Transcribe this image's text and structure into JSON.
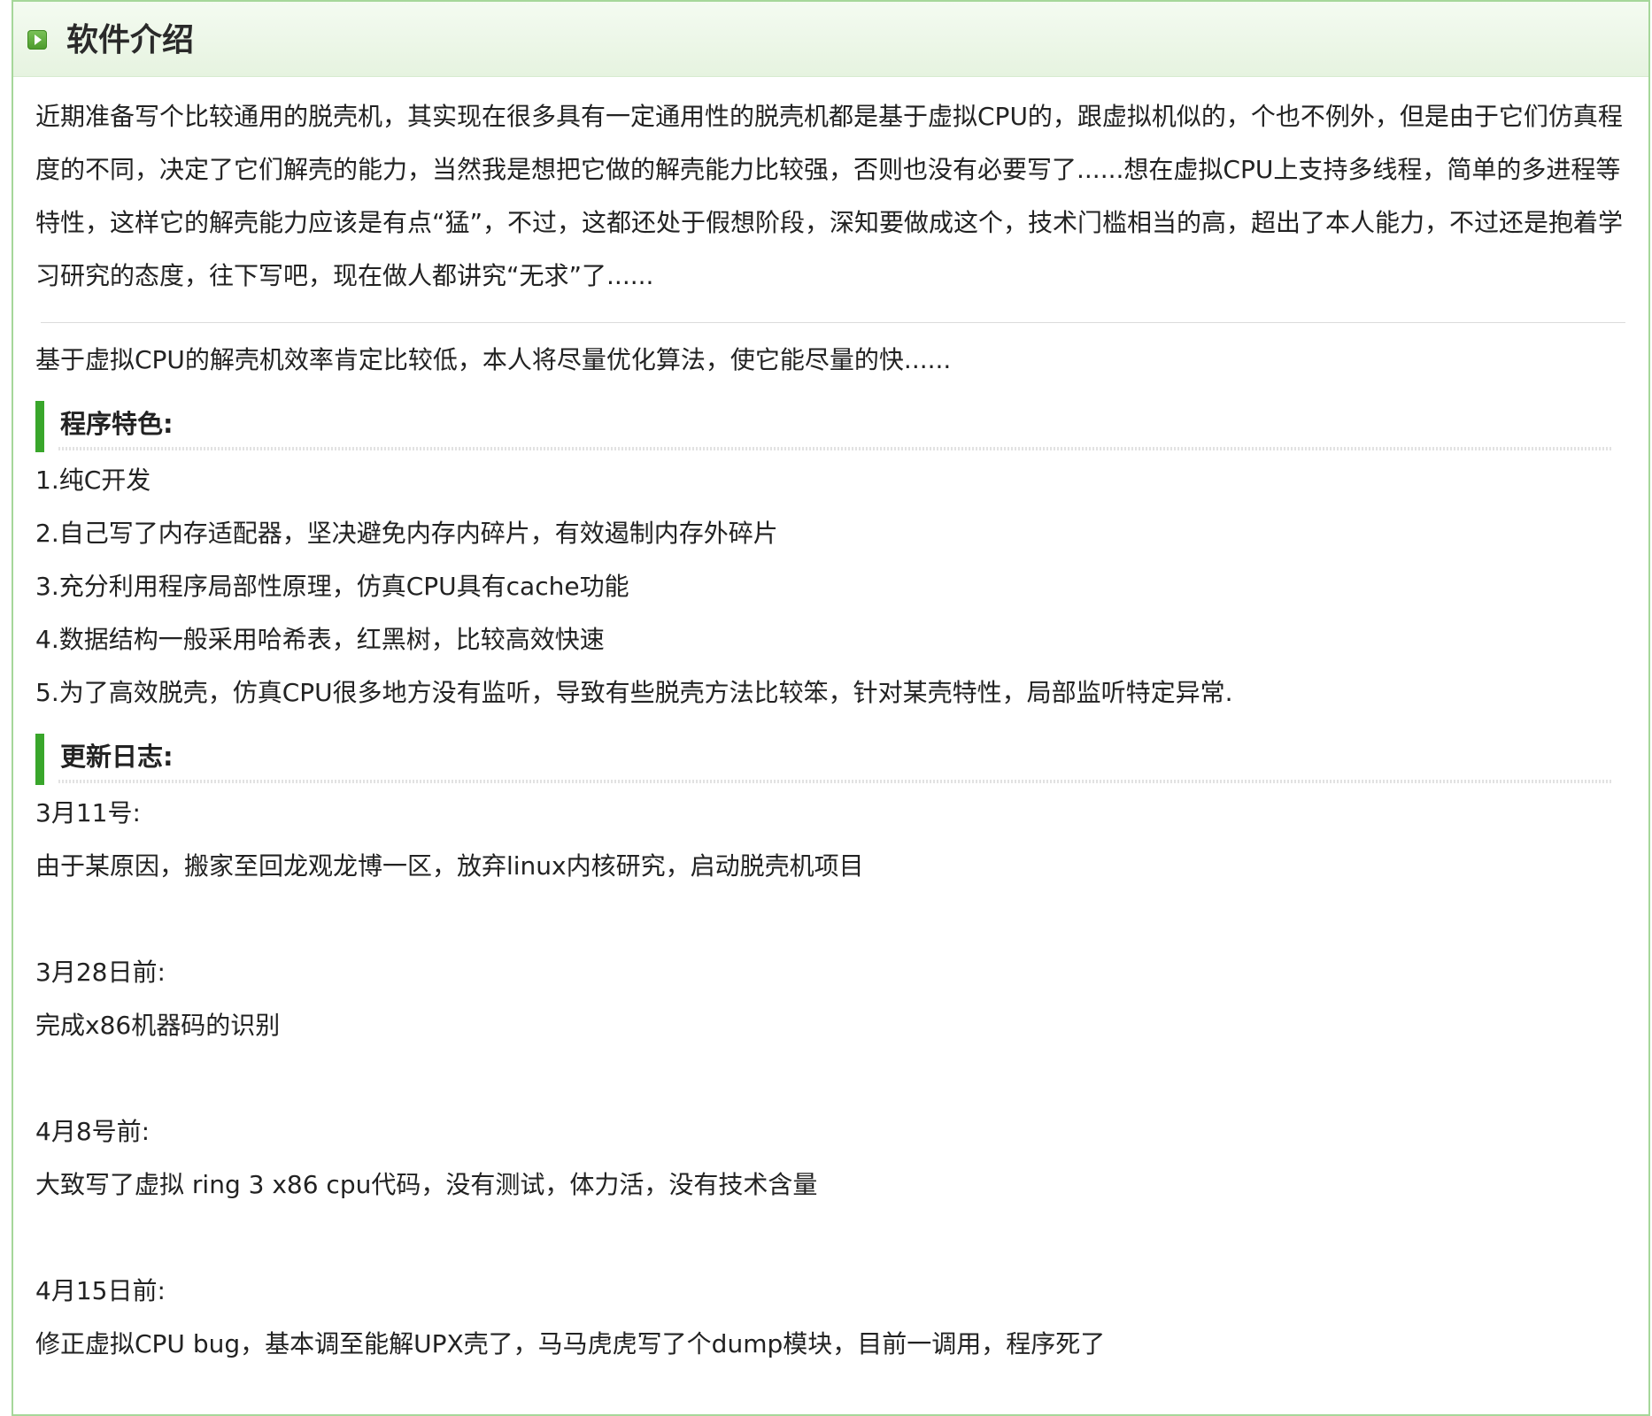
{
  "header": {
    "icon": "play-square-icon",
    "title": "软件介绍"
  },
  "intro": {
    "paragraph": "近期准备写个比较通用的脱壳机，其实现在很多具有一定通用性的脱壳机都是基于虚拟CPU的，跟虚拟机似的，个也不例外，但是由于它们仿真程度的不同，决定了它们解壳的能力，当然我是想把它做的解壳能力比较强，否则也没有必要写了......想在虚拟CPU上支持多线程，简单的多进程等特性，这样它的解壳能力应该是有点“猛”，不过，这都还处于假想阶段，深知要做成这个，技术门槛相当的高，超出了本人能力，不过还是抱着学习研究的态度，往下写吧，现在做人都讲究“无求”了......",
    "efficiency_note": "基于虚拟CPU的解壳机效率肯定比较低，本人将尽量优化算法，使它能尽量的快......"
  },
  "features": {
    "title": "程序特色:",
    "items": [
      "1.纯C开发",
      "2.自己写了内存适配器，坚决避免内存内碎片，有效遏制内存外碎片",
      "3.充分利用程序局部性原理，仿真CPU具有cache功能",
      "4.数据结构一般采用哈希表，红黑树，比较高效快速",
      "5.为了高效脱壳，仿真CPU很多地方没有监听，导致有些脱壳方法比较笨，针对某壳特性，局部监听特定异常."
    ]
  },
  "changelog": {
    "title": "更新日志:",
    "entries": [
      {
        "date": "3月11号:",
        "text": "由于某原因，搬家至回龙观龙博一区，放弃linux内核研究，启动脱壳机项目"
      },
      {
        "date": "3月28日前:",
        "text": "完成x86机器码的识别"
      },
      {
        "date": "4月8号前:",
        "text": "大致写了虚拟 ring 3 x86 cpu代码，没有测试，体力活，没有技术含量"
      },
      {
        "date": "4月15日前:",
        "text": "修正虚拟CPU bug，基本调至能解UPX壳了，马马虎虎写了个dump模块，目前一调用，程序死了"
      }
    ]
  }
}
